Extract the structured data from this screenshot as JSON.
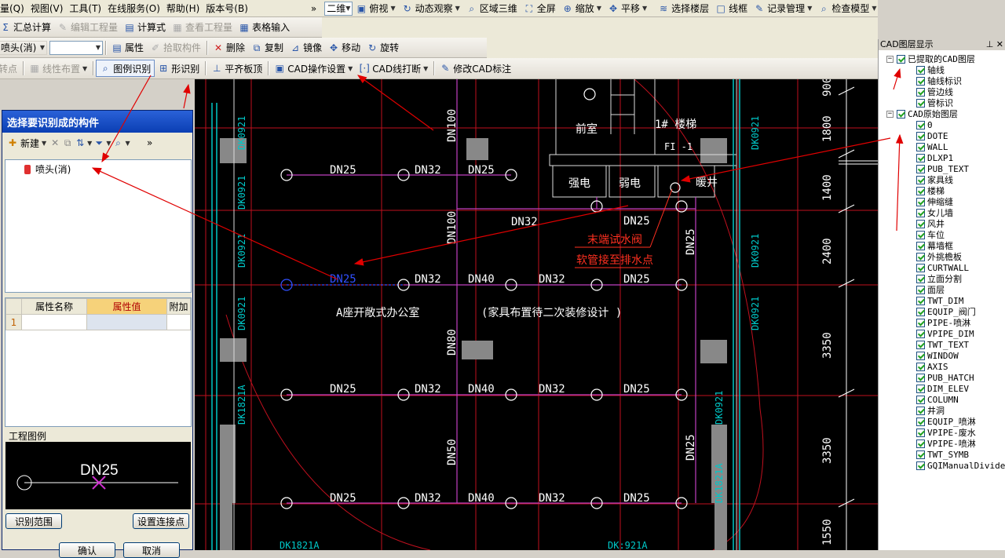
{
  "menu": {
    "items": [
      "量(Q)",
      "视图(V)",
      "工具(T)",
      "在线服务(O)",
      "帮助(H)",
      "版本号(B)"
    ],
    "view_mode": "二维",
    "items2": [
      "俯视",
      "动态观察",
      "区域三维",
      "全屏",
      "缩放",
      "平移",
      "选择楼层",
      "线框",
      "记录管理",
      "检查模型"
    ]
  },
  "toolbar2": {
    "items": [
      "汇总计算",
      "编辑工程量",
      "计算式",
      "查看工程量",
      "表格输入"
    ]
  },
  "toolbar3": {
    "component": "喷头(消)",
    "items": [
      "属性",
      "拾取构件",
      "删除",
      "复制",
      "镜像",
      "移动",
      "旋转"
    ]
  },
  "toolbar4": {
    "items": [
      "转点",
      "线性布置",
      "图例识别",
      "形识别",
      "平齐板顶",
      "CAD操作设置",
      "CAD线打断",
      "修改CAD标注"
    ]
  },
  "dialog": {
    "title": "选择要识别成的构件",
    "new_label": "新建",
    "tree_item": "喷头(消)",
    "grid_headers": [
      "属性名称",
      "属性值",
      "附加"
    ],
    "row_number": "1",
    "legend_label": "工程图例",
    "legend_text": "DN25",
    "btn_range": "识别范围",
    "btn_connect": "设置连接点",
    "btn_ok": "确认",
    "btn_cancel": "取消"
  },
  "panel": {
    "title": "CAD图层显示",
    "group1": "已提取的CAD图层",
    "group1_items": [
      "轴线",
      "轴线标识",
      "管边线",
      "管标识"
    ],
    "group2": "CAD原始图层",
    "group2_items": [
      "0",
      "DOTE",
      "WALL",
      "DLXP1",
      "PUB_TEXT",
      "家具线",
      "楼梯",
      "伸缩缝",
      "女儿墙",
      "风井",
      "车位",
      "幕墙框",
      "外挑檐板",
      "CURTWALL",
      "立面分割",
      "面层",
      "TWT_DIM",
      "EQUIP_阀门",
      "PIPE-喷淋",
      "VPIPE_DIM",
      "TWT_TEXT",
      "WINDOW",
      "AXIS",
      "PUB_HATCH",
      "DIM_ELEV",
      "COLUMN",
      "井洞",
      "EQUIP_喷淋",
      "VPIPE-废水",
      "VPIPE-喷淋",
      "TWT_SYMB",
      "GQIManualDivideBe"
    ]
  },
  "cad": {
    "pipe_labels_row1": [
      "DN25",
      "DN32",
      "DN25"
    ],
    "pipe_labels_row2": [
      "DN25",
      "DN32",
      "DN40",
      "DN32",
      "DN25"
    ],
    "pipe_labels_row3": [
      "DN25",
      "DN32",
      "DN40",
      "DN32",
      "DN25"
    ],
    "pipe_labels_row4": [
      "DN25",
      "DN32",
      "DN40",
      "DN32",
      "DN25"
    ],
    "dn32_mid": "DN32",
    "dn25_mid": "DN25",
    "vert_labels": [
      "DN100",
      "DN100",
      "DN80",
      "DN50",
      "DN25",
      "DN25"
    ],
    "room1": "前室",
    "room2": "1#  楼梯",
    "room3": "强电",
    "room4": "弱电",
    "room5": "暖井",
    "f1": "FI -1",
    "note1": "末端试水阀",
    "note2": "软管接至排水点",
    "office": "A座开敞式办公室",
    "office2": "(家具布置待二次装修设计    )",
    "dk_labels": [
      "DK0921",
      "DK0921",
      "DK0921",
      "DK0921",
      "DK1821A",
      "DK0921",
      "DK0921",
      "DK0921",
      "DK0921",
      "DK1821A",
      "DK1821A",
      "DK:921A"
    ],
    "dims": [
      "900",
      "1800",
      "1400",
      "2400",
      "3350",
      "3350",
      "1550"
    ]
  }
}
